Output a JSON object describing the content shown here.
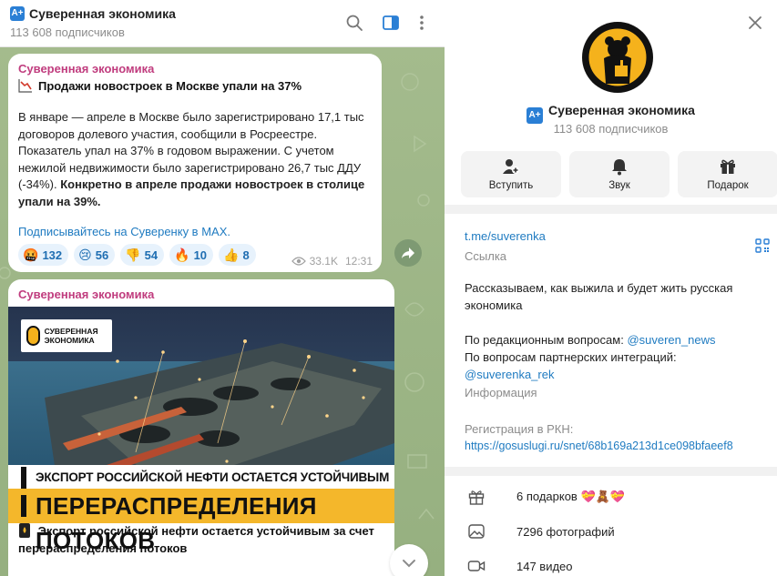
{
  "chat_header": {
    "logo": "A+",
    "title": "Суверенная экономика",
    "subscribers": "113 608 подписчиков"
  },
  "post1": {
    "author": "Суверенная экономика",
    "headline_icon": "chart-down-icon",
    "headline": "Продажи новостроек в Москве упали на 37%",
    "paragraph_plain": "В январе — апреле в Москве было зарегистрировано 17,1 тыс договоров долевого участия, сообщили в Росреестре. Показатель упал на 37% в годовом выражении. С учетом нежилой недвижимости было зарегистрировано 26,7 тыс ДДУ (-34%).",
    "paragraph_bold": "Конкретно в апреле продажи новостроек в столице упали на 39%.",
    "link": "Подписывайтесь на Суверенку в MAX.",
    "reactions": [
      {
        "emoji": "🤬",
        "count": "132"
      },
      {
        "emoji": "😢",
        "count": "56"
      },
      {
        "emoji": "👎",
        "count": "54"
      },
      {
        "emoji": "🔥",
        "count": "10"
      },
      {
        "emoji": "👍",
        "count": "8"
      }
    ],
    "views": "33.1K",
    "time": "12:31"
  },
  "post2": {
    "author": "Суверенная экономика",
    "image_tag": "СУВЕРЕННАЯ ЭКОНОМИКА",
    "banner_line1": "ЭКСПОРТ РОССИЙСКОЙ НЕФТИ ОСТАЕТСЯ УСТОЙЧИВЫМ ЗА СЧЕТ",
    "banner_line2": "ПЕРЕРАСПРЕДЕЛЕНИЯ ПОТОКОВ",
    "headline": "Экспорт российской нефти остается устойчивым за счет перераспределения потоков"
  },
  "info": {
    "logo": "A+",
    "name": "Суверенная экономика",
    "subscribers": "113 608 подписчиков",
    "actions": [
      {
        "label": "Вступить",
        "icon": "add-user-icon"
      },
      {
        "label": "Звук",
        "icon": "bell-icon"
      },
      {
        "label": "Подарок",
        "icon": "gift-icon"
      }
    ],
    "link": "t.me/suverenka",
    "link_label": "Ссылка",
    "desc_line1": "Рассказываем, как выжила и будет жить русская экономика",
    "desc_editorial": "По редакционным вопросам: ",
    "desc_editorial_handle": "@suveren_news",
    "desc_partner": "По вопросам партнерских интеграций: ",
    "desc_partner_handle": "@suverenka_rek",
    "desc_label": "Информация",
    "rkn_label": "Регистрация в РКН:",
    "rkn_link": "https://gosuslugi.ru/snet/68b169a213d1ce098bfaeef8",
    "gifts": "6 подарков",
    "gift_emojis": "💝🧸💝",
    "photos": "7296 фотографий",
    "videos": "147 видео"
  },
  "colors": {
    "accent": "#1f7bc1",
    "author": "#c03c7e",
    "chat_bg": "#9fb78a",
    "banner": "#f4b72b",
    "channel_logo": "#2a7fd5"
  }
}
